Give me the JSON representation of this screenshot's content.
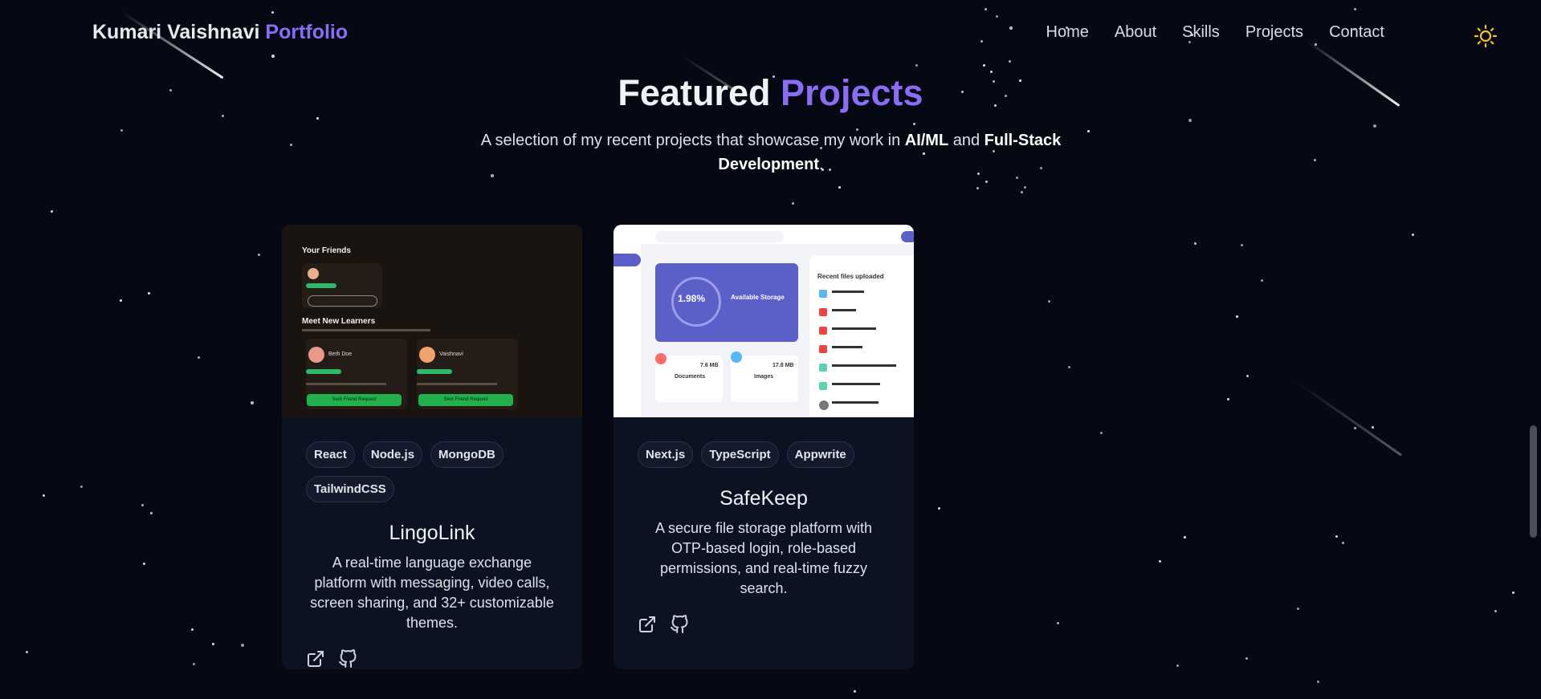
{
  "header": {
    "logo_name": "Kumari Vaishnavi",
    "logo_accent": "Portfolio",
    "nav": [
      "Home",
      "About",
      "Skills",
      "Projects",
      "Contact"
    ],
    "theme_icon": "sun-icon"
  },
  "section": {
    "title_plain": "Featured",
    "title_accent": "Projects",
    "subtitle_pre": "A selection of my recent projects that showcase my work in ",
    "subtitle_bold1": "AI/ML",
    "subtitle_mid": " and ",
    "subtitle_bold2": "Full-Stack Development",
    "subtitle_post": "."
  },
  "projects": [
    {
      "title": "LingoLink",
      "tags": [
        "React",
        "Node.js",
        "MongoDB",
        "TailwindCSS"
      ],
      "description": "A real-time language exchange platform with messaging, video calls, screen sharing, and 32+ customizable themes.",
      "thumb": {
        "friends_heading": "Your Friends",
        "learners_heading": "Meet New Learners",
        "user_a": "Beth Doe",
        "user_b": "Vaishnavi",
        "button_a": "Sent Friend Request",
        "button_b": "Sent Friend Request"
      }
    },
    {
      "title": "SafeKeep",
      "tags": [
        "Next.js",
        "TypeScript",
        "Appwrite"
      ],
      "description": "A secure file storage platform with OTP-based login, role-based permissions, and real-time fuzzy search.",
      "thumb": {
        "storage_percent": "1.98%",
        "storage_label": "Available Storage",
        "recent_heading": "Recent files uploaded",
        "documents_size": "7.6 MB",
        "documents_label": "Documents",
        "images_size": "17.8 MB",
        "images_label": "Images"
      }
    }
  ],
  "icons": {
    "external_link": "external-link-icon",
    "github": "github-icon"
  }
}
